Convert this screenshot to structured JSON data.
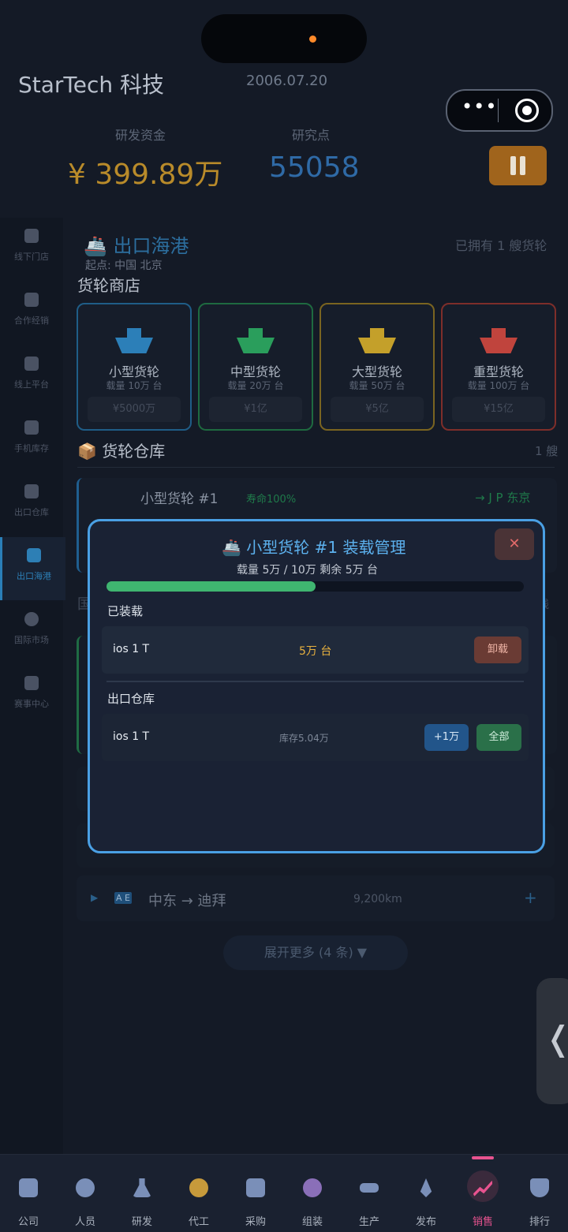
{
  "header": {
    "company": "StarTech 科技",
    "date": "2006.07.20",
    "funds_label": "研发资金",
    "funds_value": "¥ 399.89万",
    "points_label": "研究点",
    "points_value": "55058"
  },
  "sidebar": {
    "items": [
      {
        "label": "线下门店",
        "icon": "store-icon"
      },
      {
        "label": "合作经销",
        "icon": "partner-icon"
      },
      {
        "label": "线上平台",
        "icon": "online-icon"
      },
      {
        "label": "手机库存",
        "icon": "inventory-icon"
      },
      {
        "label": "出口仓库",
        "icon": "warehouse-icon"
      },
      {
        "label": "出口海港",
        "icon": "ship-icon",
        "active": true
      },
      {
        "label": "国际市场",
        "icon": "globe-icon"
      },
      {
        "label": "赛事中心",
        "icon": "trophy-icon"
      }
    ]
  },
  "port": {
    "title": "🚢 出口海港",
    "owned": "已拥有 1 艘货轮",
    "origin": "起点: 中国 北京",
    "shop_title": "货轮商店",
    "ships": [
      {
        "name": "小型货轮",
        "capacity": "载量 10万 台",
        "price": "¥5000万",
        "color": "#2c7fb8"
      },
      {
        "name": "中型货轮",
        "capacity": "载量 20万 台",
        "price": "¥1亿",
        "color": "#2a9e5c"
      },
      {
        "name": "大型货轮",
        "capacity": "载量 50万 台",
        "price": "¥5亿",
        "color": "#c4a02a"
      },
      {
        "name": "重型货轮",
        "capacity": "载量 100万 台",
        "price": "¥15亿",
        "color": "#c0443d"
      }
    ],
    "warehouse_title": "📦 货轮仓库",
    "warehouse_count": "1 艘",
    "warehouse_ship": {
      "name": "小型货轮 #1",
      "life": "寿命100%",
      "dest": "→ J P 东京"
    },
    "bg_section_title": "国",
    "bg_section_right": "线",
    "route": {
      "flag": "A E",
      "text": "中东 → 迪拜",
      "distance": "9,200km",
      "plus": "+"
    },
    "more": "展开更多 (4 条) ▼"
  },
  "modal": {
    "title": "🚢 小型货轮 #1 装载管理",
    "close": "✕",
    "subtitle": "载量 5万 / 10万    剩余 5万 台",
    "load_fraction": 0.5,
    "loaded_section": "已装载",
    "loaded_item": {
      "name": "ios 1 T",
      "qty": "5万 台",
      "action": "卸载"
    },
    "warehouse_section": "出口仓库",
    "warehouse_item": {
      "name": "ios 1 T",
      "stock": "库存5.04万",
      "add": "+1万",
      "all": "全部"
    }
  },
  "side_tab": "❬",
  "bottom_nav": [
    {
      "label": "公司",
      "icon": "building-icon",
      "color": "#7a8fb8"
    },
    {
      "label": "人员",
      "icon": "people-icon",
      "color": "#7a8fb8"
    },
    {
      "label": "研发",
      "icon": "flask-icon",
      "color": "#7a8fb8"
    },
    {
      "label": "代工",
      "icon": "gear-icon",
      "color": "#c79a3b"
    },
    {
      "label": "采购",
      "icon": "bag-icon",
      "color": "#7a8fb8"
    },
    {
      "label": "组装",
      "icon": "assemble-icon",
      "color": "#8a6fb8"
    },
    {
      "label": "生产",
      "icon": "factory-icon",
      "color": "#7a8fb8"
    },
    {
      "label": "发布",
      "icon": "rocket-icon",
      "color": "#7a8fb8"
    },
    {
      "label": "销售",
      "icon": "trend-icon",
      "color": "#e8538f",
      "active": true
    },
    {
      "label": "排行",
      "icon": "trophy-icon",
      "color": "#7a8fb8"
    }
  ]
}
